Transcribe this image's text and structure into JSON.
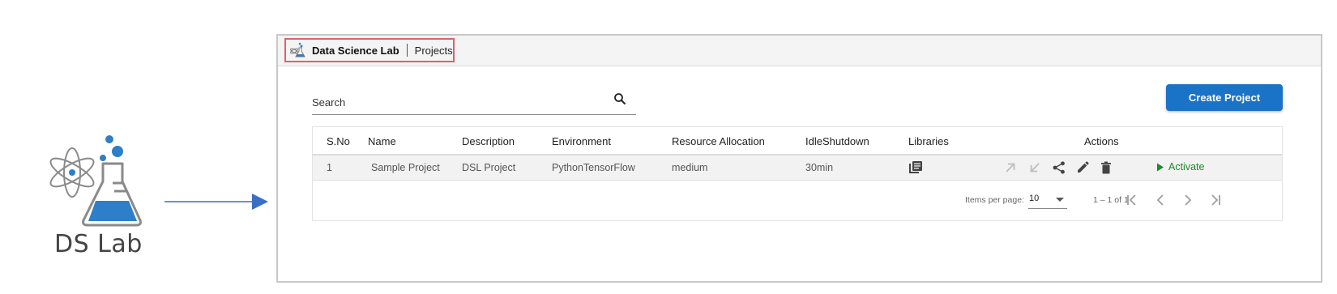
{
  "logo": {
    "text": "DS Lab"
  },
  "app": {
    "name": "Data Science Lab",
    "page": "Projects"
  },
  "search": {
    "placeholder": "Search"
  },
  "create_button": {
    "label": "Create Project"
  },
  "table": {
    "headers": [
      "S.No",
      "Name",
      "Description",
      "Environment",
      "Resource Allocation",
      "IdleShutdown",
      "Libraries",
      "Actions"
    ],
    "rows": [
      {
        "sno": "1",
        "name": "Sample Project",
        "description": "DSL Project",
        "environment": "PythonTensorFlow",
        "resource": "medium",
        "idle": "30min",
        "action_label": "Activate"
      }
    ]
  },
  "paginator": {
    "items_per_page_label": "Items per page:",
    "items_per_page": "10",
    "range": "1 – 1 of 1"
  },
  "icons": {
    "libraries": "library-books-icon",
    "actions": [
      "push-icon",
      "pull-icon",
      "share-icon",
      "edit-icon",
      "delete-icon",
      "play-icon"
    ]
  },
  "colors": {
    "primary": "#1a73c6",
    "activate": "#1e8a2a",
    "highlight_border": "#d9636a",
    "arrow": "#3b6fc4"
  }
}
